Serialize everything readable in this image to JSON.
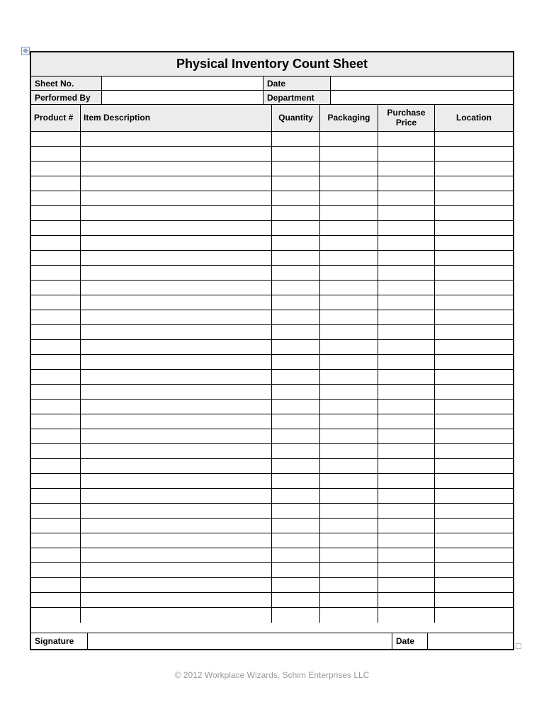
{
  "title": "Physical Inventory Count Sheet",
  "meta": {
    "sheet_no_label": "Sheet No.",
    "date_label": "Date",
    "performed_by_label": "Performed By",
    "department_label": "Department"
  },
  "columns": {
    "product_no": "Product #",
    "item_desc": "Item Description",
    "quantity": "Quantity",
    "packaging": "Packaging",
    "purchase_price": "Purchase Price",
    "location": "Location"
  },
  "row_count": 33,
  "signature": {
    "signature_label": "Signature",
    "date_label": "Date"
  },
  "footer": "© 2012 Workplace Wizards, Schim Enterprises LLC",
  "anchor_glyph": "✥"
}
